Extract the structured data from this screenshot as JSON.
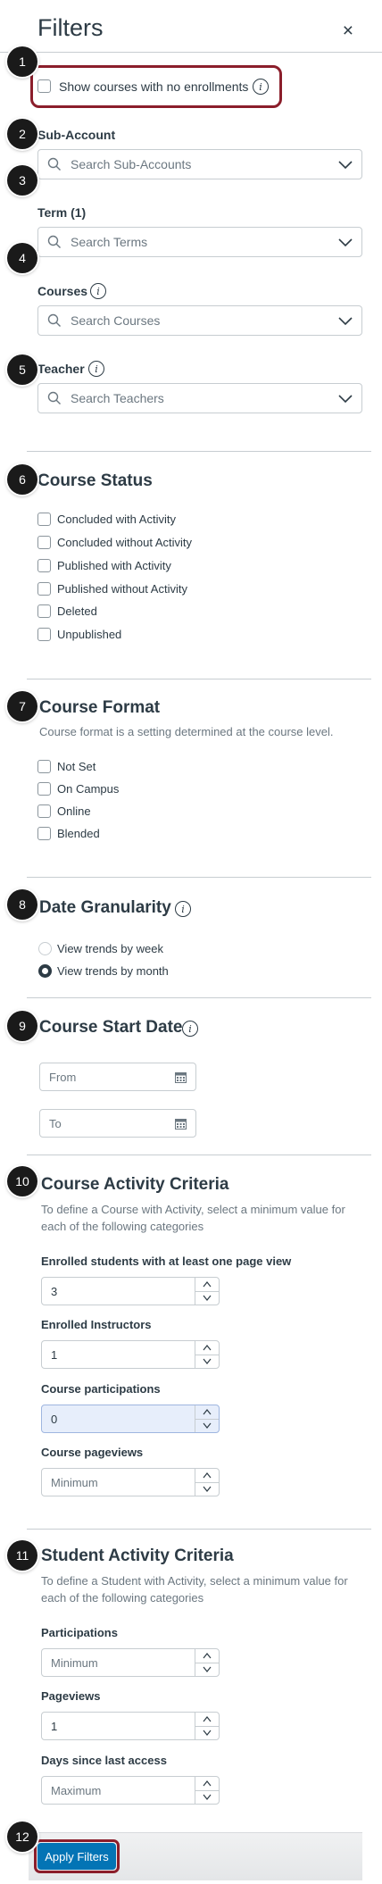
{
  "header": {
    "title": "Filters",
    "close_glyph": "×"
  },
  "badges": [
    "1",
    "2",
    "3",
    "4",
    "5",
    "6",
    "7",
    "8",
    "9",
    "10",
    "11",
    "12"
  ],
  "no_enrollments": {
    "label": "Show courses with no enrollments"
  },
  "sub_account": {
    "label": "Sub-Account",
    "placeholder": "Search Sub-Accounts"
  },
  "term": {
    "label": "Term (1)",
    "placeholder": "Search Terms"
  },
  "courses": {
    "label": "Courses",
    "placeholder": "Search Courses"
  },
  "teacher": {
    "label": "Teacher",
    "placeholder": "Search Teachers"
  },
  "course_status": {
    "title": "Course Status",
    "options": [
      "Concluded with Activity",
      "Concluded without Activity",
      "Published with Activity",
      "Published without Activity",
      "Deleted",
      "Unpublished"
    ]
  },
  "course_format": {
    "title": "Course Format",
    "description": "Course format is a setting determined at the course level.",
    "options": [
      "Not Set",
      "On Campus",
      "Online",
      "Blended"
    ]
  },
  "date_granularity": {
    "title": "Date Granularity",
    "options": [
      "View trends by week",
      "View trends by month"
    ],
    "selected": "View trends by month"
  },
  "course_start_date": {
    "title": "Course Start Date",
    "from_placeholder": "From",
    "to_placeholder": "To"
  },
  "course_activity": {
    "title": "Course Activity Criteria",
    "description_line1": "To define a Course with Activity, select a minimum value for",
    "description_line2": "each of the following categories",
    "fields": [
      {
        "label": "Enrolled students with at least one page view",
        "value": "3",
        "placeholder": ""
      },
      {
        "label": "Enrolled Instructors",
        "value": "1",
        "placeholder": ""
      },
      {
        "label": "Course participations",
        "value": "0",
        "placeholder": ""
      },
      {
        "label": "Course pageviews",
        "value": "",
        "placeholder": "Minimum"
      }
    ]
  },
  "student_activity": {
    "title": "Student Activity Criteria",
    "description_line1": "To define a Student with Activity, select a minimum value for",
    "description_line2": "each of the following categories",
    "fields": [
      {
        "label": "Participations",
        "value": "",
        "placeholder": "Minimum"
      },
      {
        "label": "Pageviews",
        "value": "1",
        "placeholder": ""
      },
      {
        "label": "Days since last access",
        "value": "",
        "placeholder": "Maximum"
      }
    ]
  },
  "footer": {
    "apply_label": "Apply Filters"
  },
  "colors": {
    "accent": "#0374b5",
    "highlight": "#8b1e2b",
    "text": "#2d3b45",
    "muted": "#6b7780",
    "border": "#c7cdd1"
  },
  "icons": [
    "close-icon",
    "info-icon",
    "search-icon",
    "chevron-down-icon",
    "calendar-icon",
    "stepper-up-icon",
    "stepper-down-icon"
  ]
}
